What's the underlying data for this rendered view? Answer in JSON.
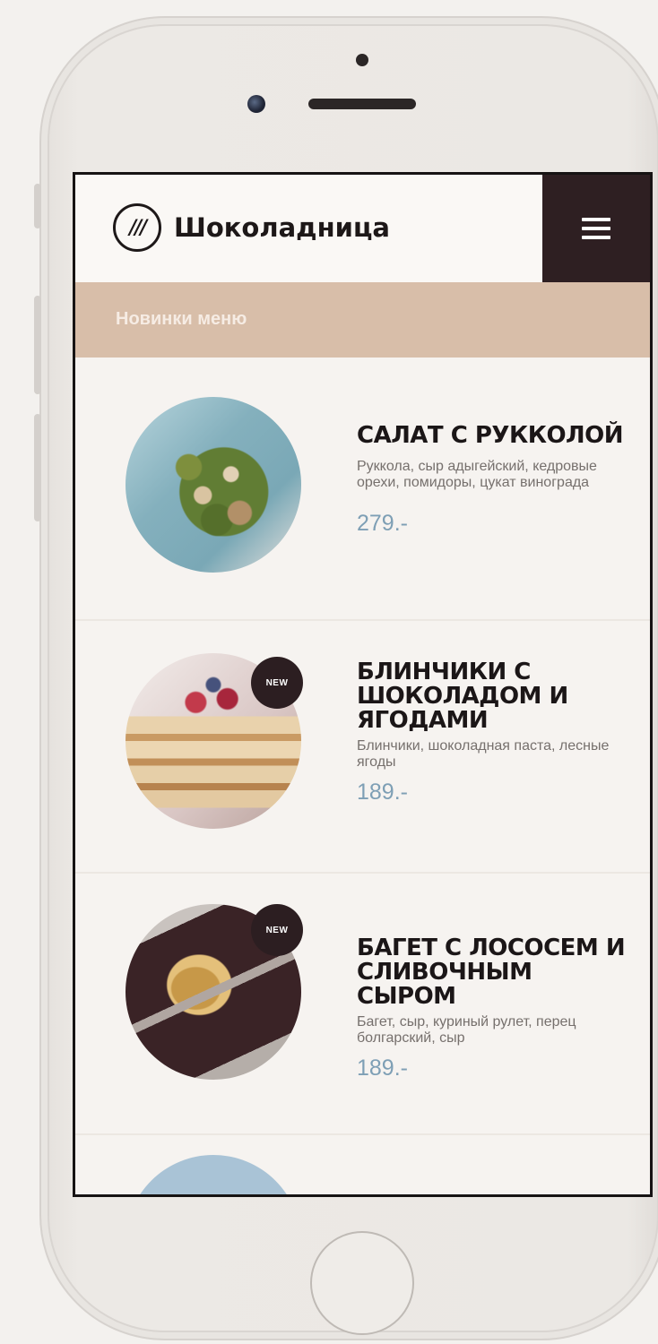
{
  "header": {
    "logo_mark": "///",
    "brand_name": "Шоколадница",
    "menu_icon": "hamburger-menu-icon"
  },
  "section": {
    "title": "Новинки меню"
  },
  "items": [
    {
      "title": "САЛАТ С РУККОЛОЙ",
      "description": "Руккола, сыр адыгейский, кедровые орехи, помидоры, цукат винограда",
      "price": "279.-",
      "badge": ""
    },
    {
      "title": "БЛИНЧИКИ С ШОКОЛАДОМ И ЯГОДАМИ",
      "description": "Блинчики, шоколадная паста, лесные ягоды",
      "price": "189.-",
      "badge": "NEW"
    },
    {
      "title": "БАГЕТ С ЛОСОСЕМ И СЛИВОЧНЫМ СЫРОМ",
      "description": "Багет, сыр, куриный рулет, перец болгарский, сыр",
      "price": "189.-",
      "badge": "NEW"
    }
  ],
  "colors": {
    "accent_dark": "#2e1f22",
    "section_bar": "#d8bea9",
    "price": "#7e9fb5",
    "background": "#f6f3f0"
  }
}
